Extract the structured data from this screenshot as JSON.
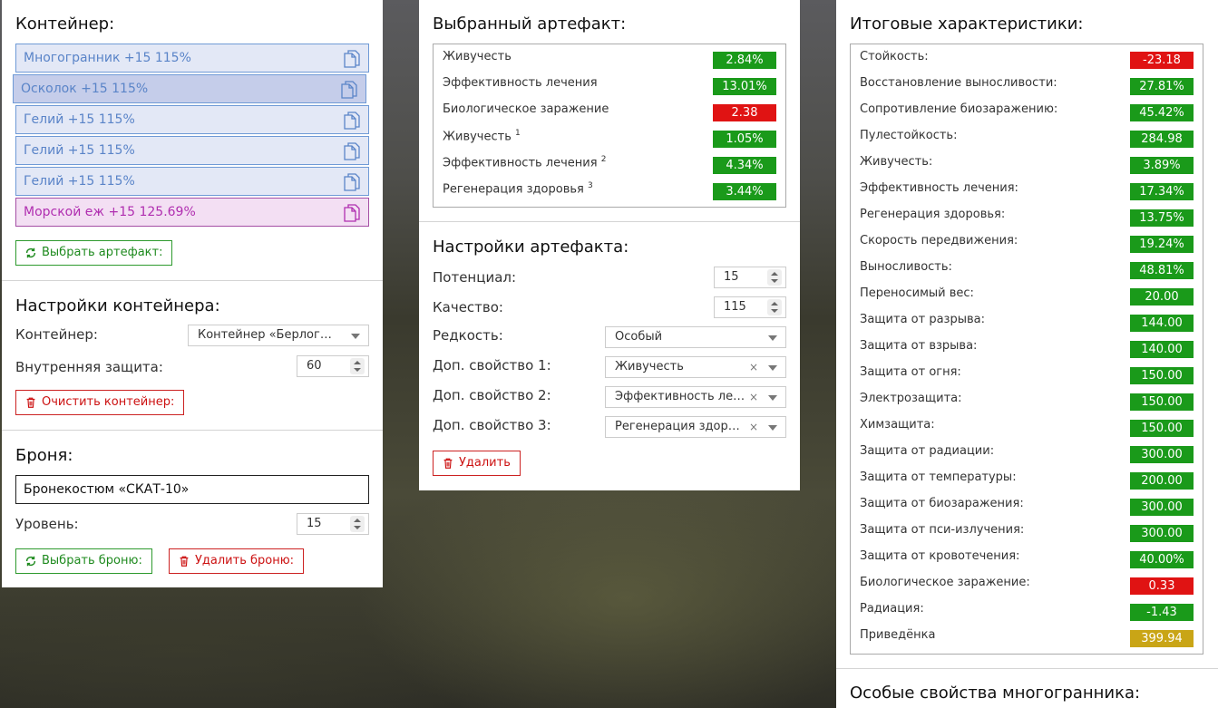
{
  "container": {
    "title": "Контейнер:",
    "items": [
      {
        "label": "Многогранник +15 115%",
        "style": "normal"
      },
      {
        "label": "Осколок +15 115%",
        "style": "selected"
      },
      {
        "label": "Гелий +15 115%",
        "style": "normal"
      },
      {
        "label": "Гелий +15 115%",
        "style": "normal"
      },
      {
        "label": "Гелий +15 115%",
        "style": "normal"
      },
      {
        "label": "Морской еж +15 125.69%",
        "style": "purple"
      }
    ],
    "choose_button": "Выбрать артефакт:"
  },
  "container_settings": {
    "title": "Настройки контейнера:",
    "container_label": "Контейнер:",
    "container_value": "Контейнер «Берлога…",
    "protection_label": "Внутренняя защита:",
    "protection_value": "60",
    "clear_button": "Очистить контейнер:"
  },
  "armor": {
    "title": "Броня:",
    "name_value": "Бронекостюм «СКАТ-10»",
    "level_label": "Уровень:",
    "level_value": "15",
    "choose_button": "Выбрать броню:",
    "delete_button": "Удалить броню:"
  },
  "selected_artifact": {
    "title": "Выбранный артефакт:",
    "stats": [
      {
        "name": "Живучесть",
        "sup": "",
        "value": "2.84%",
        "color": "green"
      },
      {
        "name": "Эффективность лечения",
        "sup": "",
        "value": "13.01%",
        "color": "green"
      },
      {
        "name": "Биологическое заражение",
        "sup": "",
        "value": "2.38",
        "color": "red"
      },
      {
        "name": "Живучесть",
        "sup": "1",
        "value": "1.05%",
        "color": "green"
      },
      {
        "name": "Эффективность лечения",
        "sup": "2",
        "value": "4.34%",
        "color": "green"
      },
      {
        "name": "Регенерация здоровья",
        "sup": "3",
        "value": "3.44%",
        "color": "green"
      }
    ]
  },
  "artifact_settings": {
    "title": "Настройки артефакта:",
    "potential_label": "Потенциал:",
    "potential_value": "15",
    "quality_label": "Качество:",
    "quality_value": "115",
    "rarity_label": "Редкость:",
    "rarity_value": "Особый",
    "prop1_label": "Доп. свойство 1:",
    "prop1_value": "Живучесть",
    "prop2_label": "Доп. свойство 2:",
    "prop2_value": "Эффективность ле…",
    "prop3_label": "Доп. свойство 3:",
    "prop3_value": "Регенерация здор…",
    "clear_symbol": "×",
    "delete_button": "Удалить"
  },
  "totals": {
    "title": "Итоговые характеристики:",
    "stats": [
      {
        "name": "Стойкость:",
        "value": "-23.18",
        "color": "red"
      },
      {
        "name": "Восстановление выносливости:",
        "value": "27.81%",
        "color": "green"
      },
      {
        "name": "Сопротивление биозаражению:",
        "value": "45.42%",
        "color": "green"
      },
      {
        "name": "Пулестойкость:",
        "value": "284.98",
        "color": "green"
      },
      {
        "name": "Живучесть:",
        "value": "3.89%",
        "color": "green"
      },
      {
        "name": "Эффективность лечения:",
        "value": "17.34%",
        "color": "green"
      },
      {
        "name": "Регенерация здоровья:",
        "value": "13.75%",
        "color": "green"
      },
      {
        "name": "Скорость передвижения:",
        "value": "19.24%",
        "color": "green"
      },
      {
        "name": "Выносливость:",
        "value": "48.81%",
        "color": "green"
      },
      {
        "name": "Переносимый вес:",
        "value": "20.00",
        "color": "green"
      },
      {
        "name": "Защита от разрыва:",
        "value": "144.00",
        "color": "green"
      },
      {
        "name": "Защита от взрыва:",
        "value": "140.00",
        "color": "green"
      },
      {
        "name": "Защита от огня:",
        "value": "150.00",
        "color": "green"
      },
      {
        "name": "Электрозащита:",
        "value": "150.00",
        "color": "green"
      },
      {
        "name": "Химзащита:",
        "value": "150.00",
        "color": "green"
      },
      {
        "name": "Защита от радиации:",
        "value": "300.00",
        "color": "green"
      },
      {
        "name": "Защита от температуры:",
        "value": "200.00",
        "color": "green"
      },
      {
        "name": "Защита от биозаражения:",
        "value": "300.00",
        "color": "green"
      },
      {
        "name": "Защита от пси-излучения:",
        "value": "300.00",
        "color": "green"
      },
      {
        "name": "Защита от кровотечения:",
        "value": "40.00%",
        "color": "green"
      },
      {
        "name": "Биологическое заражение:",
        "value": "0.33",
        "color": "red"
      },
      {
        "name": "Радиация:",
        "value": "-1.43",
        "color": "green"
      },
      {
        "name": "Приведёнка",
        "value": "399.94",
        "color": "gold"
      }
    ],
    "special_title": "Особые свойства многогранника:"
  },
  "colors": {
    "green": "#1a9a1a",
    "red": "#e01313",
    "gold": "#c9a516",
    "accent_blue": "#6f9ad6",
    "purple": "#a54fa5"
  }
}
